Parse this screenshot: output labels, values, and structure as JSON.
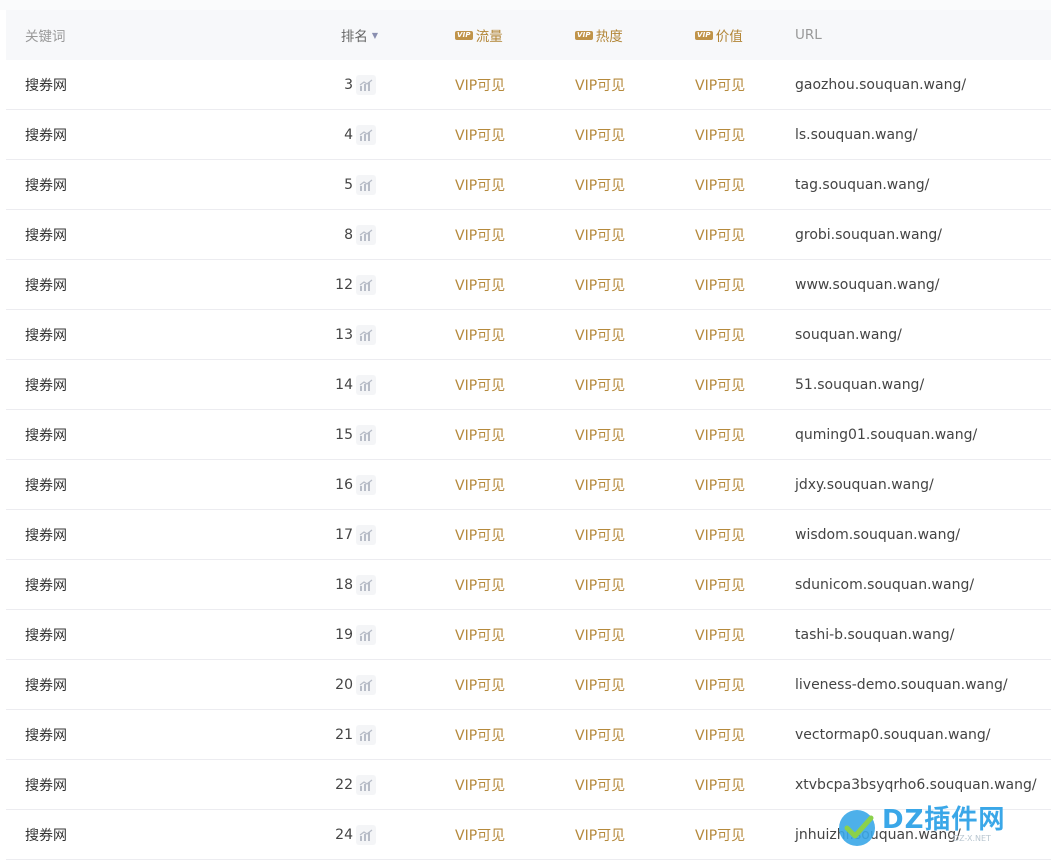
{
  "header": {
    "keyword": "关键词",
    "rank": "排名",
    "flow": "流量",
    "heat": "热度",
    "value": "价值",
    "url": "URL",
    "vip_badge": "VIP"
  },
  "rows": [
    {
      "keyword": "搜券网",
      "rank": "3",
      "flow": "VIP可见",
      "heat": "VIP可见",
      "value": "VIP可见",
      "url": "gaozhou.souquan.wang/"
    },
    {
      "keyword": "搜券网",
      "rank": "4",
      "flow": "VIP可见",
      "heat": "VIP可见",
      "value": "VIP可见",
      "url": "ls.souquan.wang/"
    },
    {
      "keyword": "搜券网",
      "rank": "5",
      "flow": "VIP可见",
      "heat": "VIP可见",
      "value": "VIP可见",
      "url": "tag.souquan.wang/"
    },
    {
      "keyword": "搜券网",
      "rank": "8",
      "flow": "VIP可见",
      "heat": "VIP可见",
      "value": "VIP可见",
      "url": "grobi.souquan.wang/"
    },
    {
      "keyword": "搜券网",
      "rank": "12",
      "flow": "VIP可见",
      "heat": "VIP可见",
      "value": "VIP可见",
      "url": "www.souquan.wang/"
    },
    {
      "keyword": "搜券网",
      "rank": "13",
      "flow": "VIP可见",
      "heat": "VIP可见",
      "value": "VIP可见",
      "url": "souquan.wang/"
    },
    {
      "keyword": "搜券网",
      "rank": "14",
      "flow": "VIP可见",
      "heat": "VIP可见",
      "value": "VIP可见",
      "url": "51.souquan.wang/"
    },
    {
      "keyword": "搜券网",
      "rank": "15",
      "flow": "VIP可见",
      "heat": "VIP可见",
      "value": "VIP可见",
      "url": "quming01.souquan.wang/"
    },
    {
      "keyword": "搜券网",
      "rank": "16",
      "flow": "VIP可见",
      "heat": "VIP可见",
      "value": "VIP可见",
      "url": "jdxy.souquan.wang/"
    },
    {
      "keyword": "搜券网",
      "rank": "17",
      "flow": "VIP可见",
      "heat": "VIP可见",
      "value": "VIP可见",
      "url": "wisdom.souquan.wang/"
    },
    {
      "keyword": "搜券网",
      "rank": "18",
      "flow": "VIP可见",
      "heat": "VIP可见",
      "value": "VIP可见",
      "url": "sdunicom.souquan.wang/"
    },
    {
      "keyword": "搜券网",
      "rank": "19",
      "flow": "VIP可见",
      "heat": "VIP可见",
      "value": "VIP可见",
      "url": "tashi-b.souquan.wang/"
    },
    {
      "keyword": "搜券网",
      "rank": "20",
      "flow": "VIP可见",
      "heat": "VIP可见",
      "value": "VIP可见",
      "url": "liveness-demo.souquan.wang/"
    },
    {
      "keyword": "搜券网",
      "rank": "21",
      "flow": "VIP可见",
      "heat": "VIP可见",
      "value": "VIP可见",
      "url": "vectormap0.souquan.wang/"
    },
    {
      "keyword": "搜券网",
      "rank": "22",
      "flow": "VIP可见",
      "heat": "VIP可见",
      "value": "VIP可见",
      "url": "xtvbcpa3bsyqrho6.souquan.wang/"
    },
    {
      "keyword": "搜券网",
      "rank": "24",
      "flow": "VIP可见",
      "heat": "VIP可见",
      "value": "VIP可见",
      "url": "jnhuizhi.souquan.wang/"
    }
  ],
  "watermark": {
    "brand": "DZ插件网",
    "sub": "DZ-X.NET"
  },
  "colors": {
    "vip_gold": "#b68a3c",
    "header_bg": "#f7f8fa",
    "row_border": "#ececf0"
  },
  "icons": {
    "sort": "sort-down-icon",
    "trend": "trend-chart-icon",
    "vip": "vip-badge-icon"
  }
}
